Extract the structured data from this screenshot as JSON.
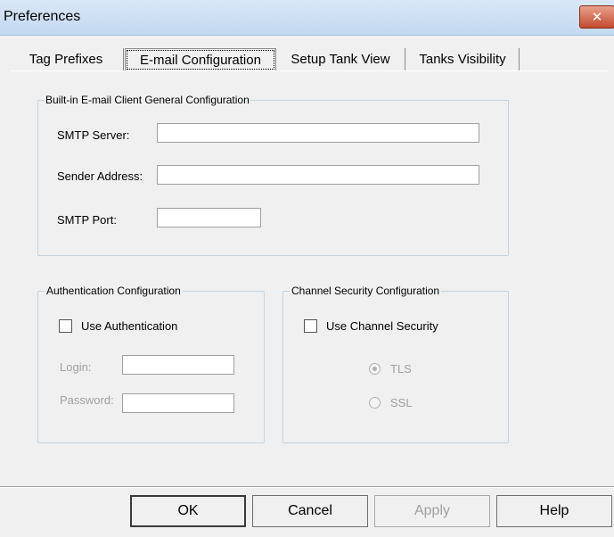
{
  "window": {
    "title": "Preferences",
    "close_glyph": "✕"
  },
  "tabs": [
    {
      "label": "Tag Prefixes"
    },
    {
      "label": "E-mail Configuration",
      "active": true
    },
    {
      "label": "Setup Tank View"
    },
    {
      "label": "Tanks Visibility"
    }
  ],
  "general": {
    "legend": "Built-in E-mail Client General Configuration",
    "smtp_server_label": "SMTP Server:",
    "smtp_server_value": "",
    "sender_address_label": "Sender Address:",
    "sender_address_value": "",
    "smtp_port_label": "SMTP Port:",
    "smtp_port_value": ""
  },
  "authentication": {
    "legend": "Authentication Configuration",
    "use_auth_label": "Use Authentication",
    "use_auth_checked": false,
    "login_label": "Login:",
    "login_value": "",
    "password_label": "Password:",
    "password_value": ""
  },
  "channel_security": {
    "legend": "Channel Security Configuration",
    "use_channel_label": "Use Channel Security",
    "use_channel_checked": false,
    "tls_label": "TLS",
    "ssl_label": "SSL",
    "selected": "TLS"
  },
  "buttons": {
    "ok": "OK",
    "cancel": "Cancel",
    "apply": "Apply",
    "help": "Help"
  }
}
